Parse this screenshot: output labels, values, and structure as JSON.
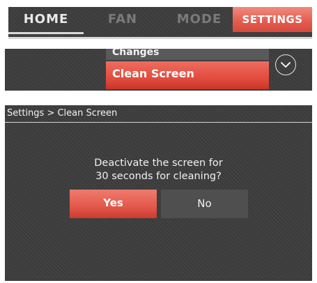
{
  "tabs": {
    "home": "HOME",
    "fan": "FAN",
    "mode": "MODE",
    "settings": "SETTINGS"
  },
  "menu": {
    "previous_item": "Changes",
    "selected_item": "Clean Screen",
    "scroll_icon": "chevron-down-circle-icon"
  },
  "dialog": {
    "breadcrumb": "Settings > Clean Screen",
    "prompt_line1": "Deactivate the screen for",
    "prompt_line2": "30 seconds for cleaning?",
    "yes_label": "Yes",
    "no_label": "No"
  },
  "colors": {
    "accent_red": "#e14a3c",
    "background_dark": "#3b3b3b",
    "text_light": "#f2f2f2"
  }
}
